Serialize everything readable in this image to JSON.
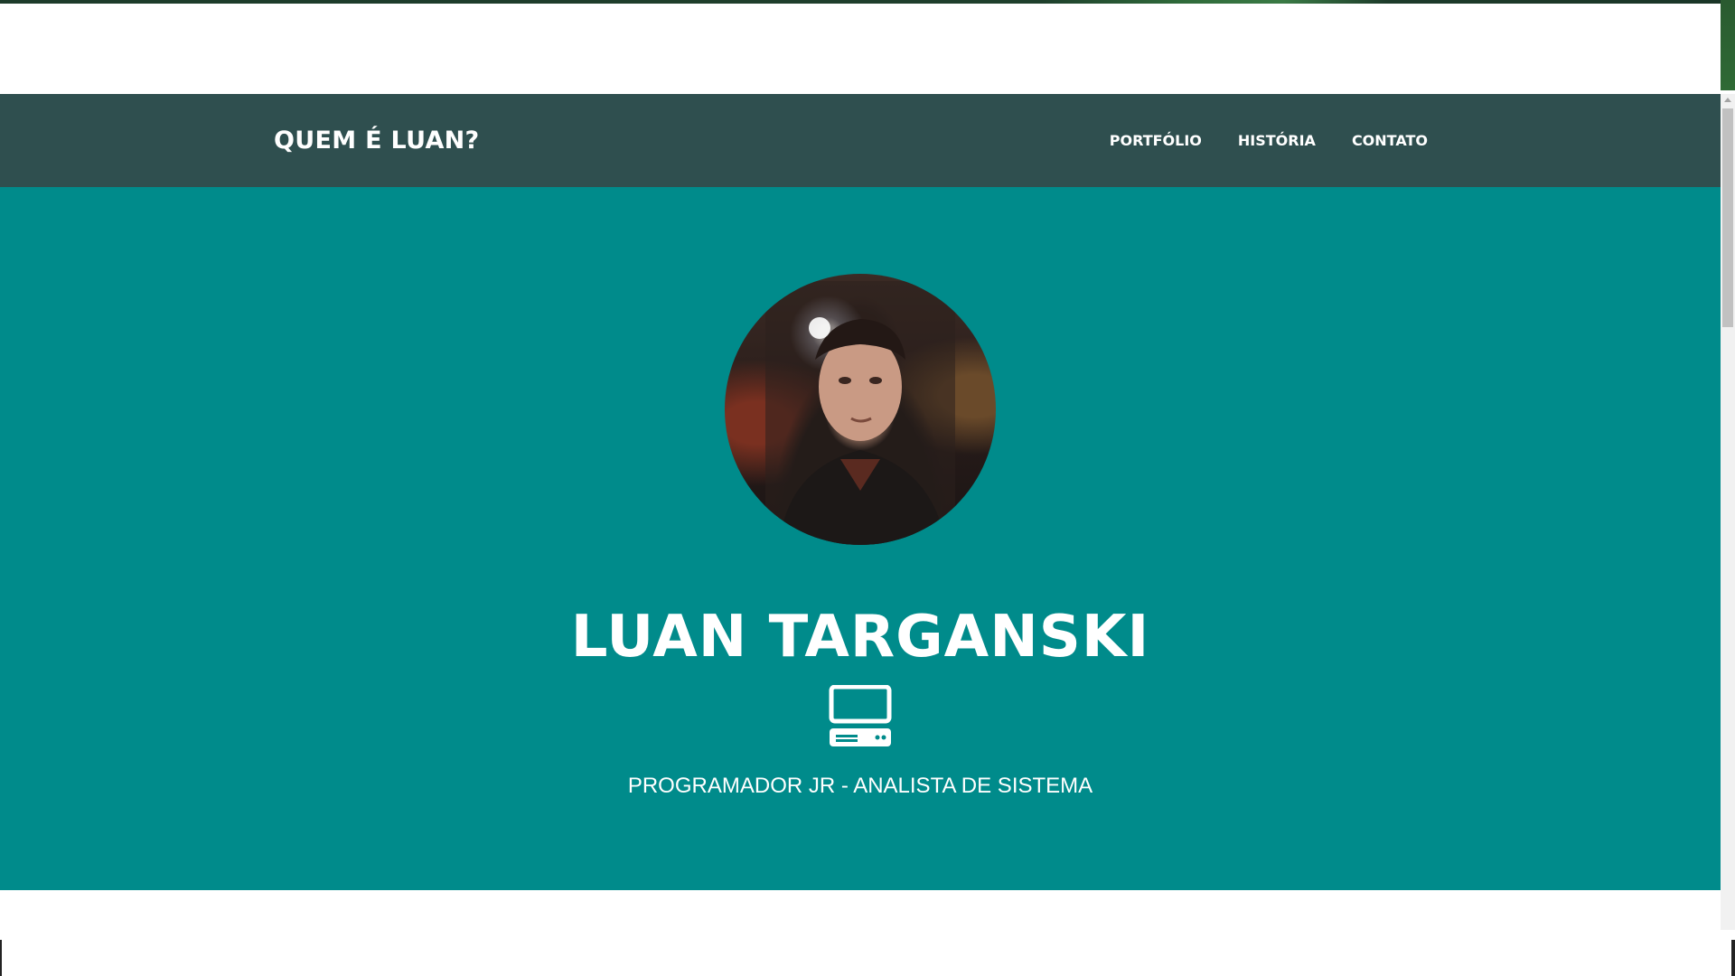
{
  "navbar": {
    "brand": "QUEM É LUAN?",
    "links": [
      {
        "label": "PORTFÓLIO"
      },
      {
        "label": "HISTÓRIA"
      },
      {
        "label": "CONTATO"
      }
    ],
    "background_color": "#2f4f4f"
  },
  "hero": {
    "name": "LUAN TARGANSKI",
    "icon": "computer-icon",
    "subtitle": "PROGRAMADOR JR - ANALISTA DE SISTEMA",
    "background_color": "#008b8b",
    "avatar": "profile-photo"
  },
  "colors": {
    "text": "#ffffff",
    "page_background": "#ffffff"
  }
}
